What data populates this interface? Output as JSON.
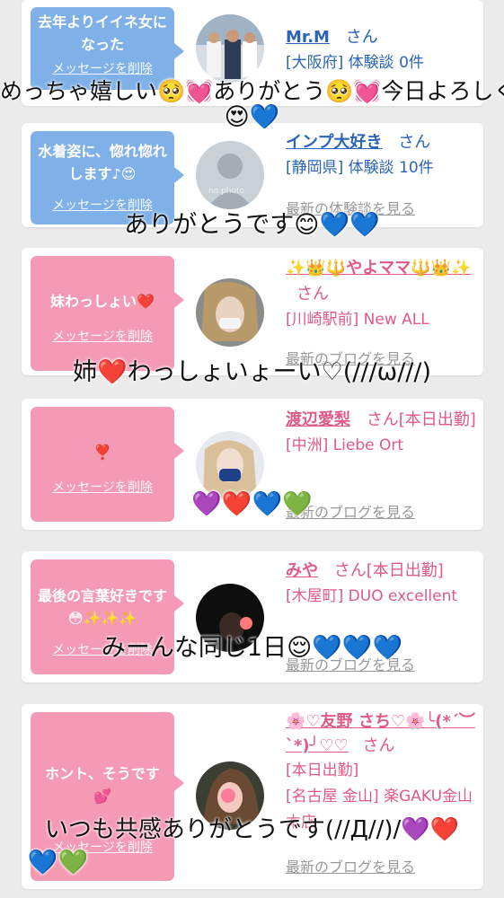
{
  "cards": [
    {
      "message": "去年よりイイネ女になった",
      "delete_label": "メッセージを削除",
      "name": "Mr.M",
      "honorific": "さん",
      "location": "[大阪府] 体験談 0件",
      "more_link": "",
      "bubble_color": "#7fb1e8",
      "text_color": "#2b64b8"
    },
    {
      "message": "水着姿に、惚れ惚れします♪😍",
      "delete_label": "メッセージを削除",
      "name": "インプ大好き",
      "honorific": "さん",
      "location": "[静岡県] 体験談 10件",
      "avatar_text": "no photo",
      "more_link": "最新の体験談を見る",
      "bubble_color": "#7fb1e8",
      "text_color": "#2b64b8"
    },
    {
      "message": "妹わっしょい❤️",
      "delete_label": "メッセージを削除",
      "name": "✨👑🔱やよママ🔱👑✨",
      "honorific": "さん",
      "location": "[川崎駅前] New ALL",
      "more_link": "最新のブログを見る",
      "bubble_color": "#f59ab4",
      "text_color": "#e05a86"
    },
    {
      "message": "❣️",
      "delete_label": "メッセージを削除",
      "name": "渡辺愛梨",
      "honorific": "さん[本日出勤]",
      "location": "[中洲] Liebe Ort",
      "more_link": "最新のブログを見る",
      "bubble_color": "#f59ab4",
      "text_color": "#e05a86"
    },
    {
      "message": "最後の言葉好きです😳✨✨✨",
      "delete_label": "メッセージを削除",
      "name": "みや",
      "honorific": "さん[本日出勤]",
      "location": "[木屋町] DUO excellent",
      "more_link": "最新のブログを見る",
      "bubble_color": "#f59ab4",
      "text_color": "#e05a86"
    },
    {
      "message": "ホント、そうです💕",
      "delete_label": "メッセージを削除",
      "name": "🌸♡友野 さち♡🌸╰(*´︶`*)╯♡♡",
      "honorific": "さん",
      "status": "[本日出勤]",
      "location": "[名古屋 金山] 楽GAKU金山本店",
      "more_link": "最新のブログを見る",
      "bubble_color": "#f59ab4",
      "text_color": "#e05a86"
    }
  ],
  "overlays": [
    "めっちゃ嬉しい🥺💓ありがとう🥺💓今日よろしく",
    "😍💙",
    "ありがとうです😊💙💙",
    "姉❤️わっしょいょーい♡(///ω///)",
    "💜❤️💙💚",
    "みーんな同じ1日😌💙💙💙",
    "いつも共感ありがとうです(//Д//)/💜❤️",
    "💙💚"
  ]
}
